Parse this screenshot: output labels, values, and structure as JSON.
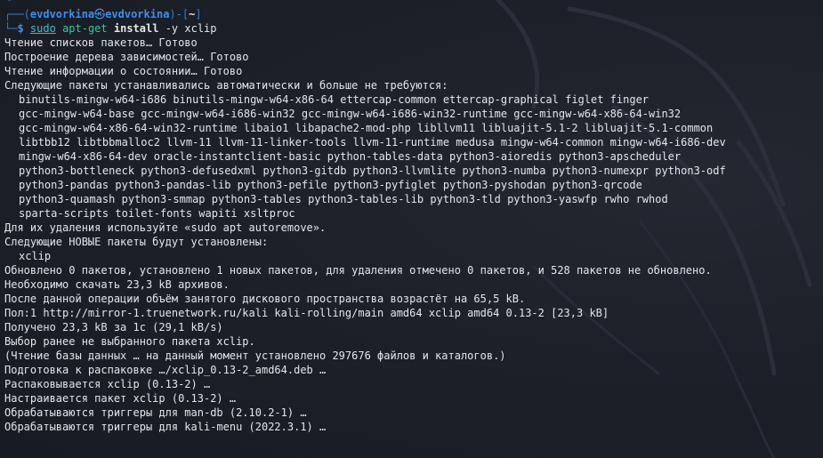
{
  "colors": {
    "background": "#1a1e26",
    "text": "#e4e6ea",
    "prompt_frame": "#2f7fd8",
    "prompt_user": "#3d8ef0",
    "command_main": "#33c8a6",
    "command_sudo": "#3fbbd6"
  },
  "prompt": {
    "top_left": "┌──(",
    "user": "evdvorkina",
    "separator_icon": "㉿",
    "host": "evdvorkina",
    "close_paren": ")-[",
    "cwd": "~",
    "close_bracket": "]",
    "bottom_left": "└─",
    "dollar": "$"
  },
  "command": {
    "sudo": "sudo",
    "program": "apt-get",
    "subcommand": "install",
    "option": "-y",
    "package": "xclip"
  },
  "output": {
    "l01": "Чтение списков пакетов… Готово",
    "l02": "Построение дерева зависимостей… Готово",
    "l03": "Чтение информации о состоянии… Готово",
    "l04": "Следующие пакеты устанавливались автоматически и больше не требуются:",
    "l05": "binutils-mingw-w64-i686 binutils-mingw-w64-x86-64 ettercap-common ettercap-graphical figlet finger",
    "l06": "gcc-mingw-w64-base gcc-mingw-w64-i686-win32 gcc-mingw-w64-i686-win32-runtime gcc-mingw-w64-x86-64-win32",
    "l07": "gcc-mingw-w64-x86-64-win32-runtime libaio1 libapache2-mod-php libllvm11 libluajit-5.1-2 libluajit-5.1-common",
    "l08": "libtbb12 libtbbmalloc2 llvm-11 llvm-11-linker-tools llvm-11-runtime medusa mingw-w64-common mingw-w64-i686-dev",
    "l09": "mingw-w64-x86-64-dev oracle-instantclient-basic python-tables-data python3-aioredis python3-apscheduler",
    "l10": "python3-bottleneck python3-defusedxml python3-gitdb python3-llvmlite python3-numba python3-numexpr python3-odf",
    "l11": "python3-pandas python3-pandas-lib python3-pefile python3-pyfiglet python3-pyshodan python3-qrcode",
    "l12": "python3-quamash python3-smmap python3-tables python3-tables-lib python3-tld python3-yaswfp rwho rwhod",
    "l13": "sparta-scripts toilet-fonts wapiti xsltproc",
    "l14": "Для их удаления используйте «sudo apt autoremove».",
    "l15": "Следующие НОВЫЕ пакеты будут установлены:",
    "l16": "xclip",
    "l17": "Обновлено 0 пакетов, установлено 1 новых пакетов, для удаления отмечено 0 пакетов, и 528 пакетов не обновлено.",
    "l18": "Необходимо скачать 23,3 kB архивов.",
    "l19": "После данной операции объём занятого дискового пространства возрастёт на 65,5 kB.",
    "l20": "Пол:1 http://mirror-1.truenetwork.ru/kali kali-rolling/main amd64 xclip amd64 0.13-2 [23,3 kB]",
    "l21": "Получено 23,3 kB за 1с (29,1 kB/s)",
    "l22": "Выбор ранее не выбранного пакета xclip.",
    "l23": "(Чтение базы данных … на данный момент установлено 297676 файлов и каталогов.)",
    "l24": "Подготовка к распаковке …/xclip_0.13-2_amd64.deb …",
    "l25": "Распаковывается xclip (0.13-2) …",
    "l26": "Настраивается пакет xclip (0.13-2) …",
    "l27": "Обрабатываются триггеры для man-db (2.10.2-1) …",
    "l28": "Обрабатываются триггеры для kali-menu (2022.3.1) …"
  }
}
